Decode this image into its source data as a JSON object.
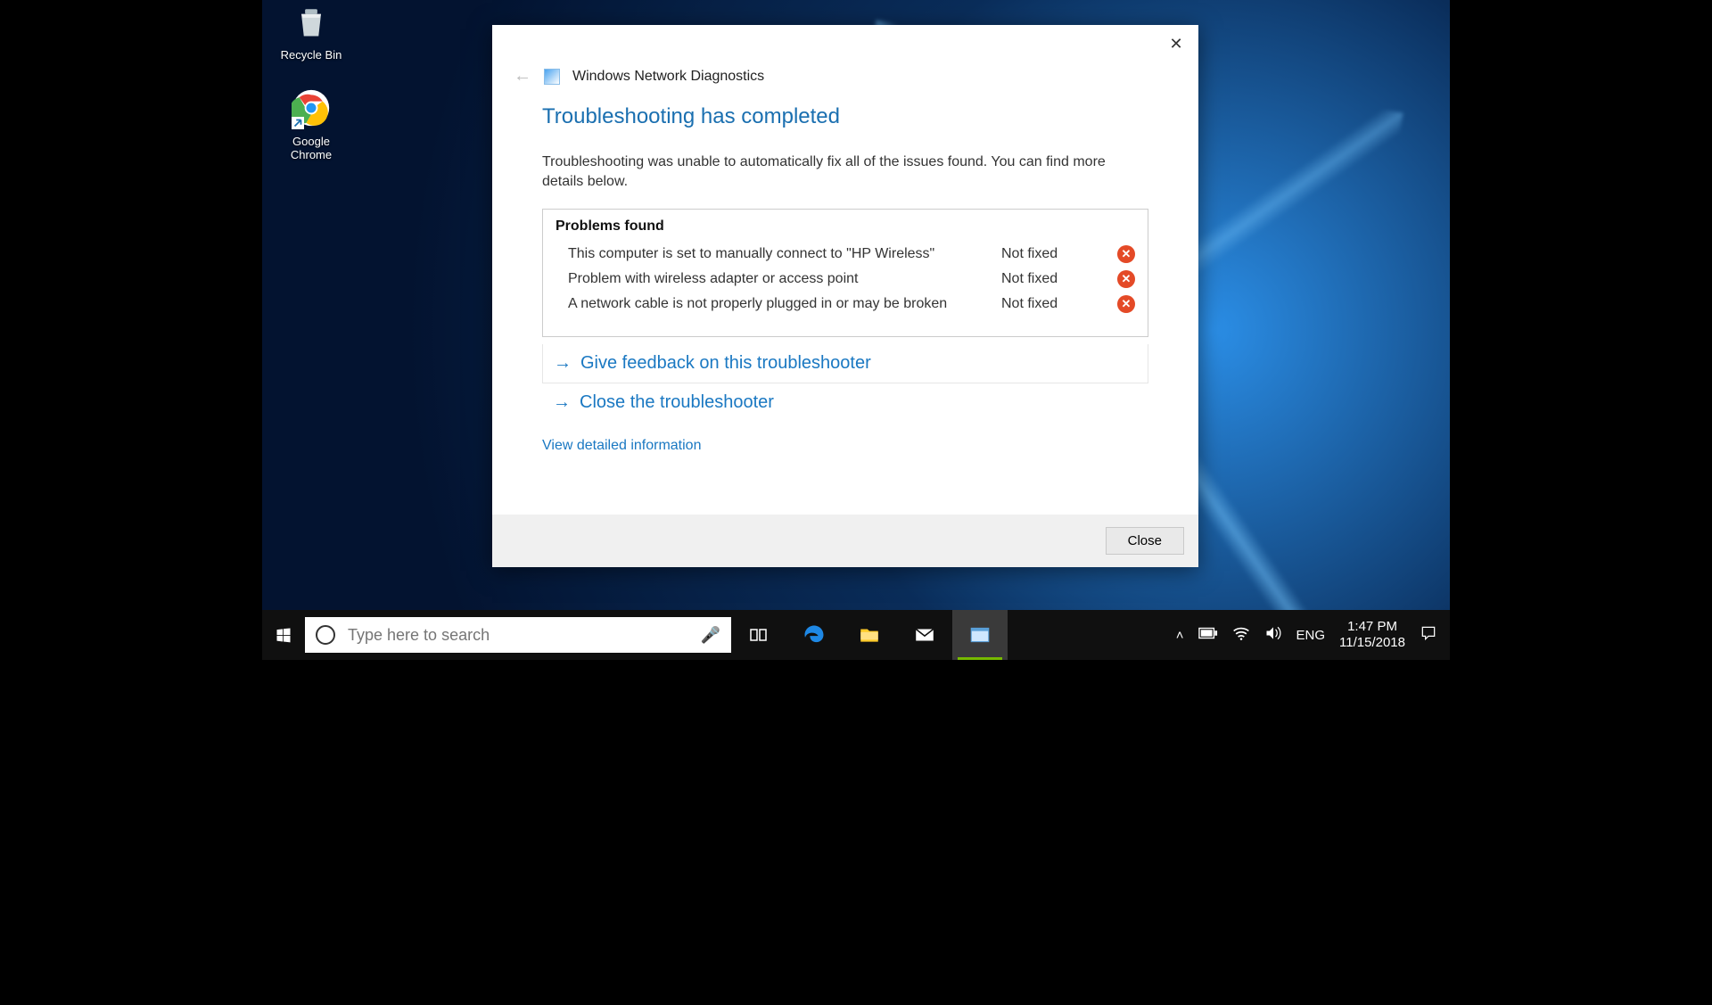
{
  "desktop": {
    "icons": [
      {
        "name": "recycle-bin",
        "label": "Recycle Bin"
      },
      {
        "name": "google-chrome",
        "label": "Google\nChrome"
      }
    ]
  },
  "dialog": {
    "app_title": "Windows Network Diagnostics",
    "heading": "Troubleshooting has completed",
    "subtext": "Troubleshooting was unable to automatically fix all of the issues found. You can find more details below.",
    "problems_heading": "Problems found",
    "problems": [
      {
        "desc": "This computer is set to manually connect to \"HP Wireless\"",
        "status": "Not fixed"
      },
      {
        "desc": "Problem with wireless adapter or access point",
        "status": "Not fixed"
      },
      {
        "desc": "A network cable is not properly plugged in or may be broken",
        "status": "Not fixed"
      }
    ],
    "action_feedback": "Give feedback on this troubleshooter",
    "action_close_ts": "Close the troubleshooter",
    "detail_link": "View detailed information",
    "close_button": "Close"
  },
  "taskbar": {
    "search_placeholder": "Type here to search",
    "language": "ENG",
    "time": "1:47 PM",
    "date": "11/15/2018"
  }
}
